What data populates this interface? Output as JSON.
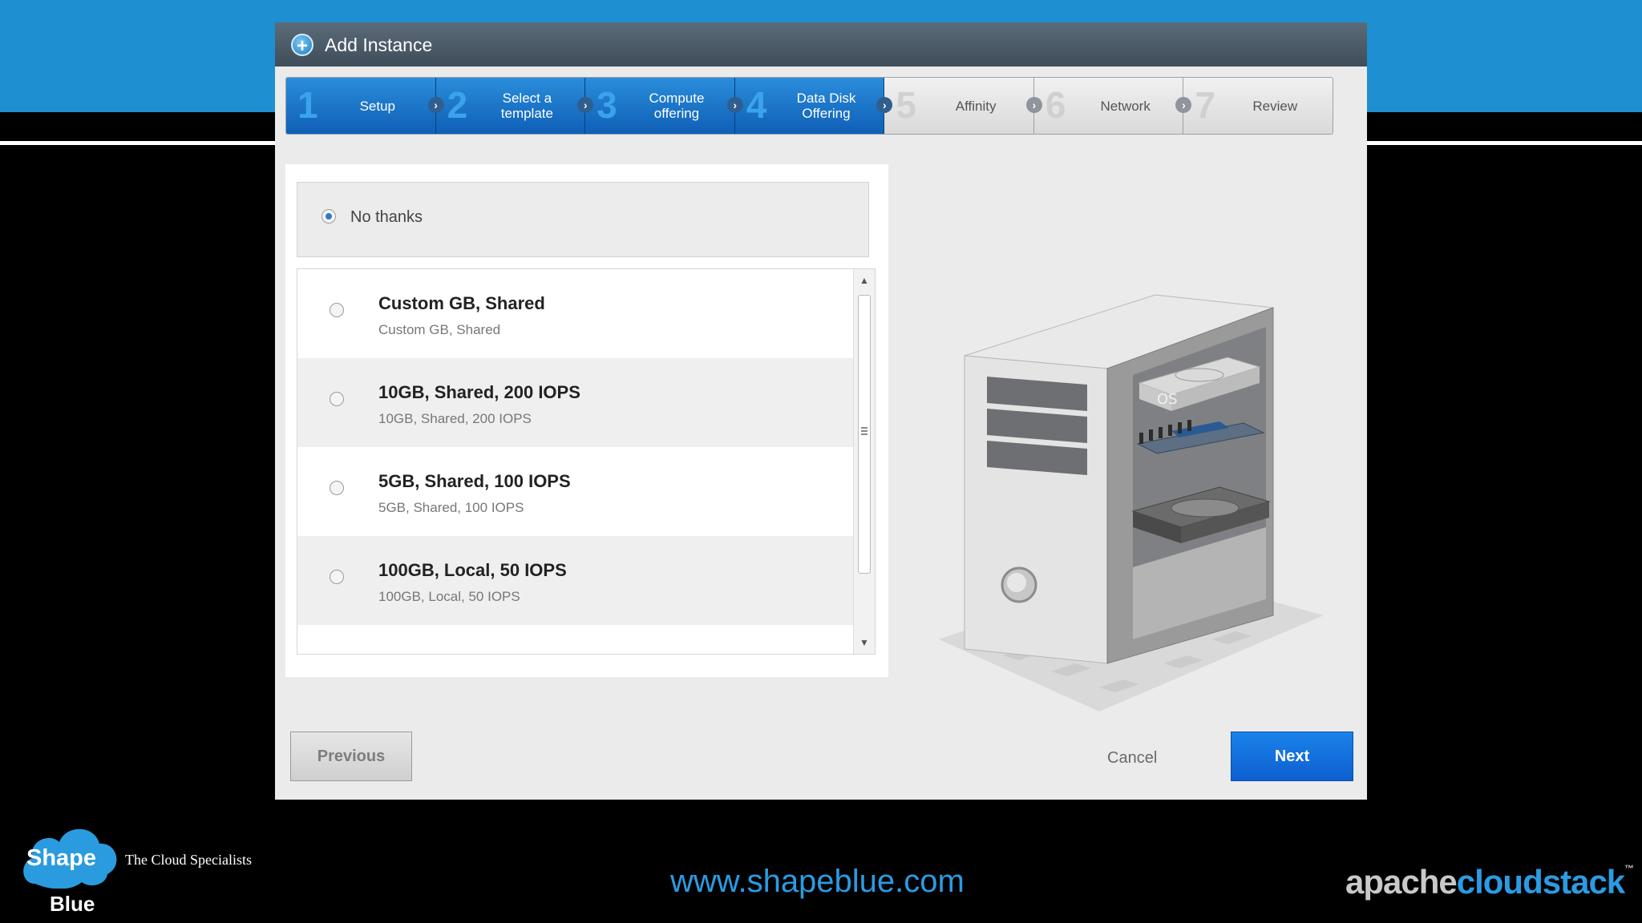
{
  "dialog": {
    "title": "Add Instance",
    "icon": "plus-circle-icon"
  },
  "steps": [
    {
      "number": "1",
      "label": "Setup",
      "state": "done"
    },
    {
      "number": "2",
      "label": "Select a\ntemplate",
      "state": "done"
    },
    {
      "number": "3",
      "label": "Compute\noffering",
      "state": "done"
    },
    {
      "number": "4",
      "label": "Data Disk\nOffering",
      "state": "current"
    },
    {
      "number": "5",
      "label": "Affinity",
      "state": "pending"
    },
    {
      "number": "6",
      "label": "Network",
      "state": "pending"
    },
    {
      "number": "7",
      "label": "Review",
      "state": "pending"
    }
  ],
  "no_thanks": {
    "label": "No thanks",
    "selected": true
  },
  "disk_offerings": [
    {
      "title": "Custom GB, Shared",
      "subtitle": "Custom GB, Shared"
    },
    {
      "title": "10GB, Shared, 200 IOPS",
      "subtitle": "10GB, Shared, 200 IOPS"
    },
    {
      "title": "5GB, Shared, 100 IOPS",
      "subtitle": "5GB, Shared, 100 IOPS"
    },
    {
      "title": "100GB, Local, 50 IOPS",
      "subtitle": "100GB, Local, 50 IOPS"
    }
  ],
  "illustration": {
    "disk_label": "OS"
  },
  "buttons": {
    "previous": "Previous",
    "cancel": "Cancel",
    "next": "Next"
  },
  "footer": {
    "logo_shape": "Shape",
    "logo_blue": "Blue",
    "tagline": "The Cloud Specialists",
    "url": "www.shapeblue.com",
    "brand_part1": "apache",
    "brand_part2": "cloudstack",
    "brand_tm": "™"
  },
  "colors": {
    "accent_blue": "#1e8fd0",
    "step_active": "#1a74c9",
    "next_button": "#0d6be0"
  }
}
